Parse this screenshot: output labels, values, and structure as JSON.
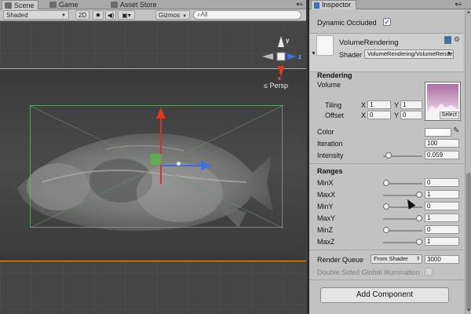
{
  "scene_panel": {
    "tabs": [
      {
        "label": "Scene",
        "active": true
      },
      {
        "label": "Game",
        "active": false
      },
      {
        "label": "Asset Store",
        "active": false
      }
    ],
    "toolbar": {
      "shading_mode": "Shaded",
      "mode_2d": "2D",
      "gizmos": "Gizmos",
      "search_placeholder": "All"
    },
    "projection_label": "Persp",
    "orientation_axes": {
      "y": "y",
      "x": "x",
      "z": "z"
    },
    "colors": {
      "bounds_outer": "#ff9a1a",
      "bounds_inner": "#66ae66",
      "axis_y": "#e03a20",
      "axis_x": "#3c6fe0",
      "plane_handle": "#5cb34c"
    }
  },
  "inspector": {
    "tab_label": "Inspector",
    "dynamic_occluded": {
      "label": "Dynamic Occluded",
      "checked": true
    },
    "material": {
      "name": "VolumeRendering",
      "shader_label": "Shader",
      "shader_value": "VolumeRendering/VolumeRender"
    },
    "rendering_header": "Rendering",
    "volume": {
      "label": "Volume",
      "tiling_label": "Tiling",
      "offset_label": "Offset",
      "x_label": "X",
      "y_label": "Y",
      "tiling_x": "1",
      "tiling_y": "1",
      "offset_x": "0",
      "offset_y": "0",
      "select_label": "Select"
    },
    "color_label": "Color",
    "iteration": {
      "label": "Iteration",
      "value": "100"
    },
    "intensity": {
      "label": "Intensity",
      "value": "0.059",
      "fraction": 0.06
    },
    "ranges_header": "Ranges",
    "ranges": [
      {
        "label": "MinX",
        "value": "0",
        "fraction": 0
      },
      {
        "label": "MaxX",
        "value": "1",
        "fraction": 1
      },
      {
        "label": "MinY",
        "value": "0",
        "fraction": 0
      },
      {
        "label": "MaxY",
        "value": "1",
        "fraction": 1
      },
      {
        "label": "MinZ",
        "value": "0",
        "fraction": 0
      },
      {
        "label": "MaxZ",
        "value": "1",
        "fraction": 1
      }
    ],
    "render_queue": {
      "label": "Render Queue",
      "mode": "From Shader",
      "value": "3000"
    },
    "double_sided_gi": {
      "label": "Double Sided Global Illumination",
      "checked": false
    },
    "add_component": "Add Component"
  }
}
